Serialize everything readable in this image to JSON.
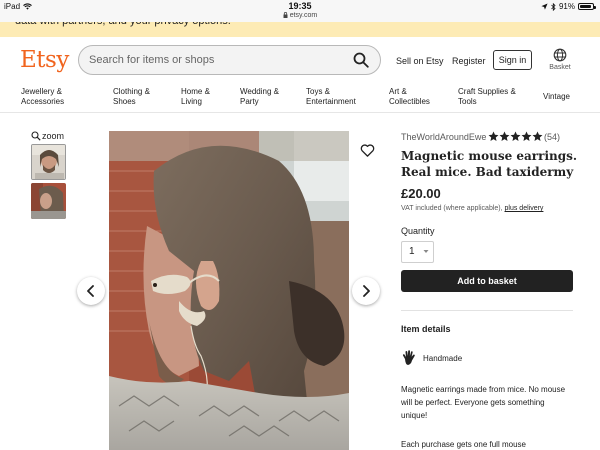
{
  "status_bar": {
    "device": "iPad",
    "time": "19:35",
    "url": "etsy.com",
    "battery_text": "91%",
    "battery_level": 0.91
  },
  "banner": {
    "text": "data with partners, and your privacy options."
  },
  "header": {
    "logo": "Etsy",
    "search_placeholder": "Search for items or shops",
    "sell_label": "Sell on Etsy",
    "register_label": "Register",
    "signin_label": "Sign in",
    "basket_label": "Basket"
  },
  "categories": [
    {
      "line1": "Jewellery &",
      "line2": "Accessories"
    },
    {
      "line1": "Clothing &",
      "line2": "Shoes"
    },
    {
      "line1": "Home &",
      "line2": "Living"
    },
    {
      "line1": "Wedding &",
      "line2": "Party"
    },
    {
      "line1": "Toys &",
      "line2": "Entertainment"
    },
    {
      "line1": "Art &",
      "line2": "Collectibles"
    },
    {
      "line1": "Craft Supplies &",
      "line2": "Tools"
    },
    {
      "line1": "Vintage",
      "line2": ""
    }
  ],
  "gallery": {
    "zoom_label": "zoom"
  },
  "product": {
    "shop_name": "TheWorldAroundEwe",
    "rating": 5,
    "review_count": "(54)",
    "title": "Magnetic mouse earrings. Real mice. Bad taxidermy",
    "price": "£20.00",
    "vat_text": "VAT included (where applicable),",
    "vat_link": "plus delivery",
    "quantity_label": "Quantity",
    "quantity_value": "1",
    "add_to_basket": "Add to basket",
    "details_heading": "Item details",
    "handmade_label": "Handmade",
    "description": "Magnetic earrings made from mice. No mouse will be perfect. Everyone gets something unique!",
    "description_more": "Each purchase gets one full mouse"
  },
  "colors": {
    "brand": "#f1641e",
    "banner": "#fdebb5",
    "button_dark": "#222222"
  }
}
